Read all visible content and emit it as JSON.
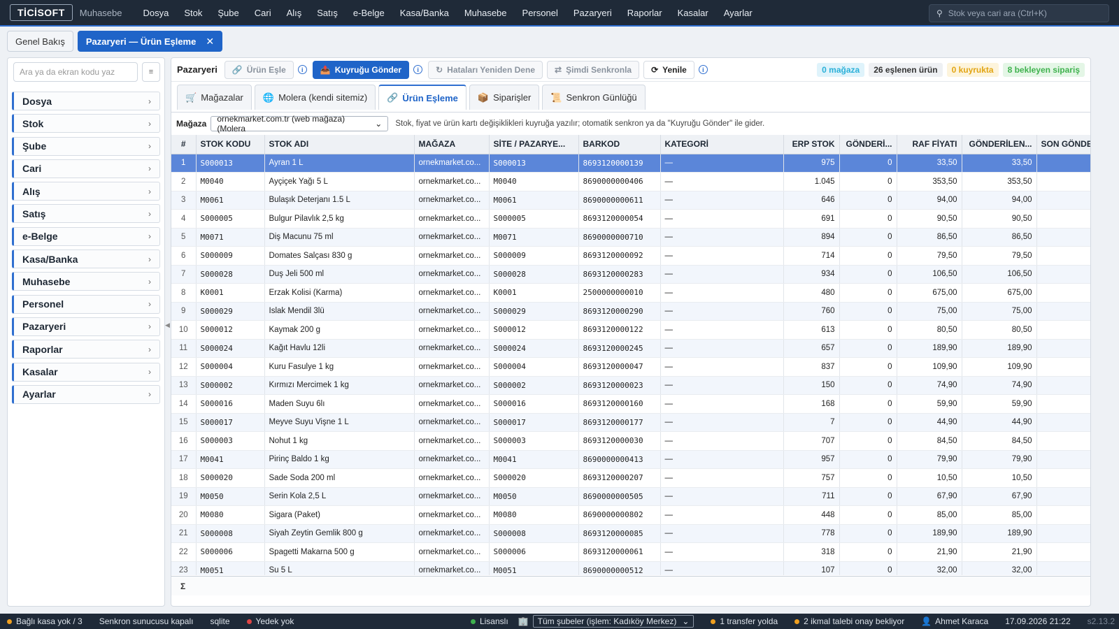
{
  "app": {
    "logo": "TİCİSOFT",
    "module": "Muhasebe"
  },
  "menu": [
    "Dosya",
    "Stok",
    "Şube",
    "Cari",
    "Alış",
    "Satış",
    "e-Belge",
    "Kasa/Banka",
    "Muhasebe",
    "Personel",
    "Pazaryeri",
    "Raporlar",
    "Kasalar",
    "Ayarlar"
  ],
  "search": {
    "placeholder": "Stok veya cari ara (Ctrl+K)"
  },
  "page_tabs": {
    "overview": "Genel Bakış",
    "active": "Pazaryeri — Ürün Eşleme",
    "close": "✕"
  },
  "sidebar": {
    "search_placeholder": "Ara ya da ekran kodu yaz",
    "items": [
      "Dosya",
      "Stok",
      "Şube",
      "Cari",
      "Alış",
      "Satış",
      "e-Belge",
      "Kasa/Banka",
      "Muhasebe",
      "Personel",
      "Pazaryeri",
      "Raporlar",
      "Kasalar",
      "Ayarlar"
    ]
  },
  "toolbar": {
    "title": "Pazaryeri",
    "match": "Ürün Eşle",
    "send_queue": "Kuyruğu Gönder",
    "retry": "Hataları Yeniden Dene",
    "sync_now": "Şimdi Senkronla",
    "refresh": "Yenile"
  },
  "badges": {
    "stores": "0 mağaza",
    "matched": "26 eşlenen ürün",
    "queued": "0 kuyrukta",
    "pending": "8 bekleyen sipariş"
  },
  "subtabs": {
    "stores": "Mağazalar",
    "molera": "Molera (kendi sitemiz)",
    "matching": "Ürün Eşleme",
    "orders": "Siparişler",
    "log": "Senkron Günlüğü"
  },
  "filter": {
    "label": "Mağaza",
    "selected": "ornekmarket.com.tr (web mağaza) (Molera",
    "hint": "Stok, fiyat ve ürün kartı değişiklikleri kuyruğa yazılır; otomatik senkron ya da \"Kuyruğu Gönder\" ile gider."
  },
  "columns": [
    "#",
    "STOK KODU",
    "STOK ADI",
    "MAĞAZA",
    "SİTE / PAZARYE...",
    "BARKOD",
    "KATEGORİ",
    "ERP STOK",
    "GÖNDERİ...",
    "RAF FİYATI",
    "GÖNDERİLEN...",
    "SON GÖNDE"
  ],
  "rows": [
    [
      "1",
      "S000013",
      "Ayran 1 L",
      "ornekmarket.co...",
      "S000013",
      "8693120000139",
      "—",
      "975",
      "0",
      "33,50",
      "33,50",
      ""
    ],
    [
      "2",
      "M0040",
      "Ayçiçek Yağı 5 L",
      "ornekmarket.co...",
      "M0040",
      "8690000000406",
      "—",
      "1.045",
      "0",
      "353,50",
      "353,50",
      ""
    ],
    [
      "3",
      "M0061",
      "Bulaşık Deterjanı 1.5 L",
      "ornekmarket.co...",
      "M0061",
      "8690000000611",
      "—",
      "646",
      "0",
      "94,00",
      "94,00",
      ""
    ],
    [
      "4",
      "S000005",
      "Bulgur Pilavlık 2,5 kg",
      "ornekmarket.co...",
      "S000005",
      "8693120000054",
      "—",
      "691",
      "0",
      "90,50",
      "90,50",
      ""
    ],
    [
      "5",
      "M0071",
      "Diş Macunu 75 ml",
      "ornekmarket.co...",
      "M0071",
      "8690000000710",
      "—",
      "894",
      "0",
      "86,50",
      "86,50",
      ""
    ],
    [
      "6",
      "S000009",
      "Domates Salçası 830 g",
      "ornekmarket.co...",
      "S000009",
      "8693120000092",
      "—",
      "714",
      "0",
      "79,50",
      "79,50",
      ""
    ],
    [
      "7",
      "S000028",
      "Duş Jeli 500 ml",
      "ornekmarket.co...",
      "S000028",
      "8693120000283",
      "—",
      "934",
      "0",
      "106,50",
      "106,50",
      ""
    ],
    [
      "8",
      "K0001",
      "Erzak Kolisi (Karma)",
      "ornekmarket.co...",
      "K0001",
      "2500000000010",
      "—",
      "480",
      "0",
      "675,00",
      "675,00",
      ""
    ],
    [
      "9",
      "S000029",
      "Islak Mendil 3lü",
      "ornekmarket.co...",
      "S000029",
      "8693120000290",
      "—",
      "760",
      "0",
      "75,00",
      "75,00",
      ""
    ],
    [
      "10",
      "S000012",
      "Kaymak 200 g",
      "ornekmarket.co...",
      "S000012",
      "8693120000122",
      "—",
      "613",
      "0",
      "80,50",
      "80,50",
      ""
    ],
    [
      "11",
      "S000024",
      "Kağıt Havlu 12li",
      "ornekmarket.co...",
      "S000024",
      "8693120000245",
      "—",
      "657",
      "0",
      "189,90",
      "189,90",
      ""
    ],
    [
      "12",
      "S000004",
      "Kuru Fasulye 1 kg",
      "ornekmarket.co...",
      "S000004",
      "8693120000047",
      "—",
      "837",
      "0",
      "109,90",
      "109,90",
      ""
    ],
    [
      "13",
      "S000002",
      "Kırmızı Mercimek 1 kg",
      "ornekmarket.co...",
      "S000002",
      "8693120000023",
      "—",
      "150",
      "0",
      "74,90",
      "74,90",
      ""
    ],
    [
      "14",
      "S000016",
      "Maden Suyu 6lı",
      "ornekmarket.co...",
      "S000016",
      "8693120000160",
      "—",
      "168",
      "0",
      "59,90",
      "59,90",
      ""
    ],
    [
      "15",
      "S000017",
      "Meyve Suyu Vişne 1 L",
      "ornekmarket.co...",
      "S000017",
      "8693120000177",
      "—",
      "7",
      "0",
      "44,90",
      "44,90",
      ""
    ],
    [
      "16",
      "S000003",
      "Nohut 1 kg",
      "ornekmarket.co...",
      "S000003",
      "8693120000030",
      "—",
      "707",
      "0",
      "84,50",
      "84,50",
      ""
    ],
    [
      "17",
      "M0041",
      "Pirinç Baldo 1 kg",
      "ornekmarket.co...",
      "M0041",
      "8690000000413",
      "—",
      "957",
      "0",
      "79,90",
      "79,90",
      ""
    ],
    [
      "18",
      "S000020",
      "Sade Soda 200 ml",
      "ornekmarket.co...",
      "S000020",
      "8693120000207",
      "—",
      "757",
      "0",
      "10,50",
      "10,50",
      ""
    ],
    [
      "19",
      "M0050",
      "Serin Kola 2,5 L",
      "ornekmarket.co...",
      "M0050",
      "8690000000505",
      "—",
      "711",
      "0",
      "67,90",
      "67,90",
      ""
    ],
    [
      "20",
      "M0080",
      "Sigara (Paket)",
      "ornekmarket.co...",
      "M0080",
      "8690000000802",
      "—",
      "448",
      "0",
      "85,00",
      "85,00",
      ""
    ],
    [
      "21",
      "S000008",
      "Siyah Zeytin Gemlik 800 g",
      "ornekmarket.co...",
      "S000008",
      "8693120000085",
      "—",
      "778",
      "0",
      "189,90",
      "189,90",
      ""
    ],
    [
      "22",
      "S000006",
      "Spagetti Makarna 500 g",
      "ornekmarket.co...",
      "S000006",
      "8693120000061",
      "—",
      "318",
      "0",
      "21,90",
      "21,90",
      ""
    ],
    [
      "23",
      "M0051",
      "Su 5 L",
      "ornekmarket.co...",
      "M0051",
      "8690000000512",
      "—",
      "107",
      "0",
      "32,00",
      "32,00",
      ""
    ]
  ],
  "footer": {
    "sum": "Σ"
  },
  "status": {
    "kasa": "Bağlı kasa yok / 3",
    "sync": "Senkron sunucusu kapalı",
    "db": "sqlite",
    "backup": "Yedek yok",
    "license": "Lisanslı",
    "branch": "Tüm şubeler (işlem: Kadıköy Merkez)",
    "transfer": "1 transfer yolda",
    "supply": "2 ikmal talebi onay bekliyor",
    "user": "Ahmet Karaca",
    "datetime": "17.09.2026 21:22",
    "version": "s2.13.2"
  },
  "colors": {
    "accent": "#1f64c8",
    "topbar": "#1f2a38",
    "selected_row": "#5b86d9"
  }
}
